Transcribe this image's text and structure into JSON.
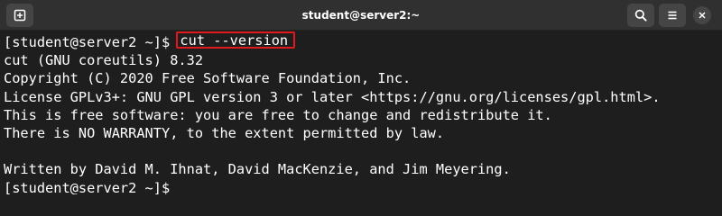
{
  "window": {
    "title": "student@server2:~"
  },
  "titlebar": {
    "new_tab_icon": "new-tab-icon",
    "search_icon": "search-icon",
    "menu_icon": "hamburger-menu-icon",
    "close_icon": "close-icon"
  },
  "terminal": {
    "prompt": "[student@server2 ~]$ ",
    "command": "cut --version",
    "output": [
      "cut (GNU coreutils) 8.32",
      "Copyright (C) 2020 Free Software Foundation, Inc.",
      "License GPLv3+: GNU GPL version 3 or later <https://gnu.org/licenses/gpl.html>.",
      "This is free software: you are free to change and redistribute it.",
      "There is NO WARRANTY, to the extent permitted by law.",
      "",
      "Written by David M. Ihnat, David MacKenzie, and Jim Meyering."
    ],
    "final_prompt": "[student@server2 ~]$ "
  },
  "colors": {
    "titlebar_bg": "#303030",
    "terminal_bg": "#1e1e1e",
    "text": "#ffffff",
    "highlight_border": "#e0191f"
  }
}
